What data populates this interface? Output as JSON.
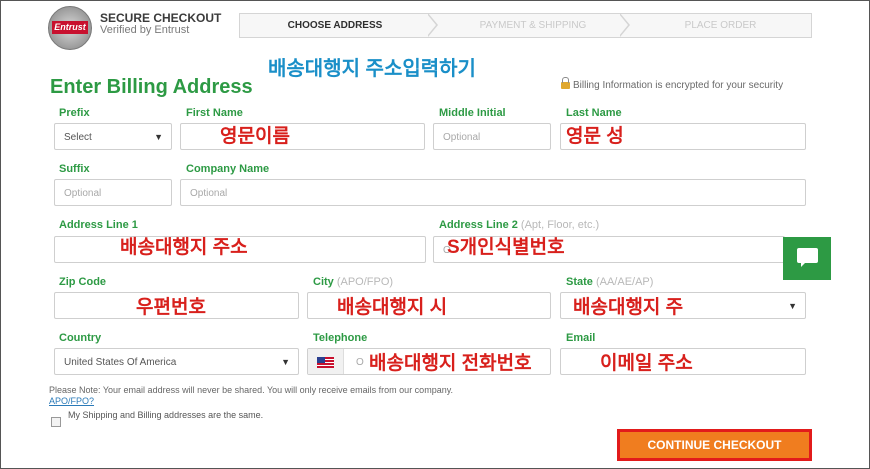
{
  "header": {
    "seal_text": "Entrust",
    "secure_title": "SECURE CHECKOUT",
    "secure_sub": "Verified by Entrust",
    "steps": [
      "CHOOSE ADDRESS",
      "PAYMENT & SHIPPING",
      "PLACE ORDER"
    ]
  },
  "overlay": {
    "heading": "배송대행지 주소입력하기",
    "first_name": "영문이름",
    "last_name": "영문 성",
    "address1": "배송대행지 주소",
    "address2": "S개인식별번호",
    "zip": "우편번호",
    "city": "배송대행지 시",
    "state": "배송대행지 주",
    "phone": "배송대행지 전화번호",
    "email": "이메일 주소"
  },
  "form": {
    "title": "Enter Billing Address",
    "encrypt_note": "Billing Information is encrypted for your security",
    "prefix": {
      "label": "Prefix",
      "value": "Select"
    },
    "first_name": {
      "label": "First Name"
    },
    "middle_initial": {
      "label": "Middle Initial",
      "placeholder": "Optional"
    },
    "last_name": {
      "label": "Last Name"
    },
    "suffix": {
      "label": "Suffix",
      "placeholder": "Optional"
    },
    "company": {
      "label": "Company Name",
      "placeholder": "Optional"
    },
    "address1": {
      "label": "Address Line 1"
    },
    "address2": {
      "label": "Address Line 2",
      "hint": "(Apt, Floor, etc.)",
      "placeholder": "O"
    },
    "zip": {
      "label": "Zip Code"
    },
    "city": {
      "label": "City",
      "hint": "(APO/FPO)"
    },
    "state": {
      "label": "State",
      "hint": "(AA/AE/AP)"
    },
    "country": {
      "label": "Country",
      "value": "United States Of America"
    },
    "telephone": {
      "label": "Telephone",
      "placeholder": "O"
    },
    "email": {
      "label": "Email"
    },
    "note": "Please Note: Your email address will never be shared. You will only receive emails from our company.",
    "apo_link": "APO/FPO?",
    "same_address": "My Shipping and Billing addresses are the same.",
    "continue_button": "CONTINUE CHECKOUT"
  },
  "colors": {
    "accent": "#2d9a44",
    "button": "#f07d1f",
    "annotation": "#d8201c",
    "heading_overlay": "#1a8fc8"
  },
  "icons": [
    "entrust-seal-icon",
    "lock-icon",
    "chevron-down-icon",
    "us-flag-icon",
    "chat-icon"
  ]
}
